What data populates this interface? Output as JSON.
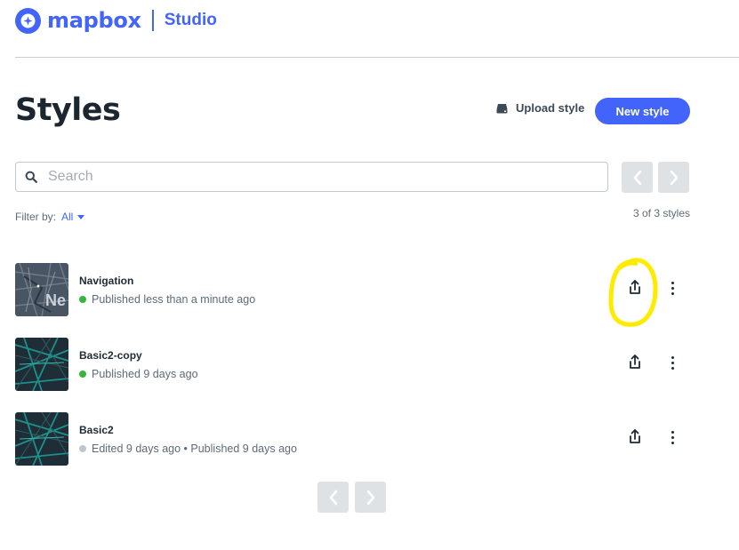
{
  "brand": {
    "name": "mapbox",
    "product": "Studio",
    "color": "#4264fb"
  },
  "page": {
    "title": "Styles"
  },
  "actions": {
    "upload_label": "Upload style",
    "new_style_label": "New style"
  },
  "search": {
    "placeholder": "Search",
    "value": ""
  },
  "filter": {
    "label": "Filter by:",
    "value": "All"
  },
  "count_text": "3 of 3 styles",
  "styles": [
    {
      "name": "Navigation",
      "status": "Published less than a minute ago",
      "status_color": "#33b73b",
      "thumbnail": "navigation-map-thumbnail"
    },
    {
      "name": "Basic2-copy",
      "status": "Published 9 days ago",
      "status_color": "#33b73b",
      "thumbnail": "dark-teal-map-thumbnail"
    },
    {
      "name": "Basic2",
      "status": "Edited 9 days ago • Published 9 days ago",
      "status_color": "#c1c6ca",
      "thumbnail": "dark-teal-map-thumbnail"
    }
  ],
  "annotation": {
    "color": "#ffeb00",
    "target": "share-icon"
  }
}
